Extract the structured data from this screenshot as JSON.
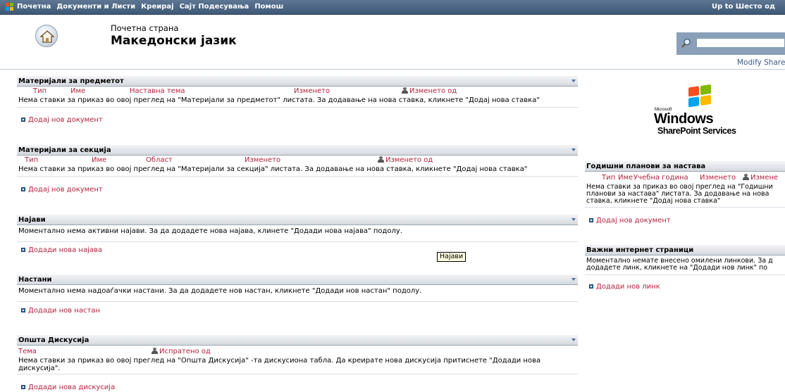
{
  "topnav": {
    "items": [
      "Почетна",
      "Документи и Листи",
      "Креирај",
      "Сајт Подесувања",
      "Помош"
    ],
    "right_text": "Up to Шесто од"
  },
  "header": {
    "breadcrumb": "Почетна страна",
    "site_title": "Македонски јазик",
    "modify_link": "Modify Share"
  },
  "left_webparts": [
    {
      "title": "Материјали за предметот",
      "columns": [
        "Тип",
        "Име",
        "Наставна тема",
        "Изменето",
        "Изменето од"
      ],
      "message": "Нема ставки за приказ во овој преглед на \"Материјали за предметот\" листата. За додавање на нова ставка, кликнете \"Додај нова ставка\"",
      "link": "Додај нов документ"
    },
    {
      "title": "Материјали за секција",
      "columns": [
        "Тип",
        "Име",
        "Област",
        "Изменето",
        "Изменето од"
      ],
      "message": "Нема ставки за приказ во овој преглед на \"Материјали за секција\" листата. За додавање на нова ставка, кликнете \"Додај нова ставка\"",
      "link": "Додај нов документ"
    },
    {
      "title": "Најави",
      "message": "Моментално нема активни најави. За да додадете нова најава, клинете \"Додади нова најава\" подолу.",
      "link": "Додади нова најава",
      "tooltip": "Најави"
    },
    {
      "title": "Настани",
      "message": "Моментално нема надоаѓачки настани. За да додадете нов настан, кликнете \"Додади нов настан\" подолу.",
      "link": "Додади нов настан"
    },
    {
      "title": "Општа Дискусија",
      "columns": [
        "Тема",
        "Испратено од"
      ],
      "message_line1": "Нема ставки за приказ во овој преглед на \"Општа Дискусија\" -та дискусиона табла. Да креирате нова дискусија притиснете \"Додади нова",
      "message_line2": "дискусија\".",
      "link": "Додади нова дискусија"
    }
  ],
  "logo": {
    "microsoft": "Microsoft",
    "windows": "Windows",
    "sharepoint": "SharePoint Services"
  },
  "right_webparts": [
    {
      "title": "Годишни планови за настава",
      "columns": [
        "Тип",
        "Име",
        "Учебна година",
        "Изменето",
        "Измене"
      ],
      "message_line1": "Нема ставки за приказ во овој преглед на \"Годишни",
      "message_line2": "планови за настава\" листата. За додавање на нова",
      "message_line3": "ставка, кликнете \"Додај нова ставка\"",
      "link": "Додај нов документ"
    },
    {
      "title": "Важни интернет страници",
      "message_line1": "Моментално немате внесено омилени линкови. За д",
      "message_line2": "додадете линк, кликнете на \"Додади нов линк\" по",
      "link": "Додади нов линк"
    }
  ],
  "colors": {
    "topbar": "#4a6382",
    "link_red": "#b3223f",
    "bullet_blue": "#3d6aa0"
  }
}
